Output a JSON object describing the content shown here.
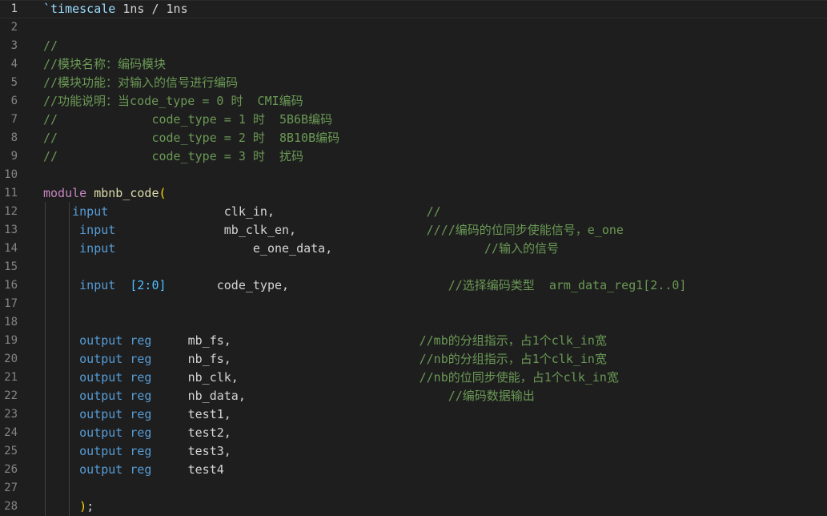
{
  "editor": {
    "lines": [
      {
        "n": "1",
        "segs": [
          {
            "t": "`timescale",
            "c": "directive"
          },
          {
            "t": " 1ns / 1ns",
            "c": "plain"
          }
        ]
      },
      {
        "n": "2",
        "segs": []
      },
      {
        "n": "3",
        "segs": [
          {
            "t": "//",
            "c": "comment"
          }
        ]
      },
      {
        "n": "4",
        "segs": [
          {
            "t": "//模块名称：编码模块",
            "c": "comment"
          }
        ]
      },
      {
        "n": "5",
        "segs": [
          {
            "t": "//模块功能：对输入的信号进行编码",
            "c": "comment"
          }
        ]
      },
      {
        "n": "6",
        "segs": [
          {
            "t": "//功能说明：当code_type = 0 时  CMI编码",
            "c": "comment"
          }
        ]
      },
      {
        "n": "7",
        "segs": [
          {
            "t": "//             code_type = 1 时  5B6B编码",
            "c": "comment"
          }
        ]
      },
      {
        "n": "8",
        "segs": [
          {
            "t": "//             code_type = 2 时  8B10B编码",
            "c": "comment"
          }
        ]
      },
      {
        "n": "9",
        "segs": [
          {
            "t": "//             code_type = 3 时  扰码",
            "c": "comment"
          }
        ]
      },
      {
        "n": "10",
        "segs": []
      },
      {
        "n": "11",
        "segs": [
          {
            "t": "module",
            "c": "module"
          },
          {
            "t": " ",
            "c": "plain"
          },
          {
            "t": "mbnb_code",
            "c": "modname"
          },
          {
            "t": "(",
            "c": "bracket"
          }
        ]
      },
      {
        "n": "12",
        "segs": [
          {
            "t": "    input",
            "c": "keyword"
          },
          {
            "t": "                clk_in,                     ",
            "c": "ident"
          },
          {
            "t": "//",
            "c": "comment"
          }
        ]
      },
      {
        "n": "13",
        "segs": [
          {
            "t": "     input",
            "c": "keyword"
          },
          {
            "t": "               mb_clk_en,                  ",
            "c": "ident"
          },
          {
            "t": "////编码的位同步使能信号，e_one",
            "c": "comment"
          }
        ]
      },
      {
        "n": "14",
        "segs": [
          {
            "t": "     input",
            "c": "keyword"
          },
          {
            "t": "                   e_one_data,                     ",
            "c": "ident"
          },
          {
            "t": "//输入的信号",
            "c": "comment"
          }
        ]
      },
      {
        "n": "15",
        "segs": []
      },
      {
        "n": "16",
        "segs": [
          {
            "t": "     input",
            "c": "keyword"
          },
          {
            "t": "  ",
            "c": "plain"
          },
          {
            "t": "[2:0]",
            "c": "range"
          },
          {
            "t": "       code_type,                      ",
            "c": "ident"
          },
          {
            "t": "//选择编码类型  arm_data_reg1[2..0]",
            "c": "comment"
          }
        ]
      },
      {
        "n": "17",
        "segs": []
      },
      {
        "n": "18",
        "segs": []
      },
      {
        "n": "19",
        "segs": [
          {
            "t": "     output reg",
            "c": "keyword"
          },
          {
            "t": "     mb_fs,                          ",
            "c": "ident"
          },
          {
            "t": "//mb的分组指示，占1个clk_in宽",
            "c": "comment"
          }
        ]
      },
      {
        "n": "20",
        "segs": [
          {
            "t": "     output reg",
            "c": "keyword"
          },
          {
            "t": "     nb_fs,                          ",
            "c": "ident"
          },
          {
            "t": "//nb的分组指示，占1个clk_in宽",
            "c": "comment"
          }
        ]
      },
      {
        "n": "21",
        "segs": [
          {
            "t": "     output reg",
            "c": "keyword"
          },
          {
            "t": "     nb_clk,                         ",
            "c": "ident"
          },
          {
            "t": "//nb的位同步使能，占1个clk_in宽",
            "c": "comment"
          }
        ]
      },
      {
        "n": "22",
        "segs": [
          {
            "t": "     output reg",
            "c": "keyword"
          },
          {
            "t": "     nb_data,                            ",
            "c": "ident"
          },
          {
            "t": "//编码数据输出",
            "c": "comment"
          }
        ]
      },
      {
        "n": "23",
        "segs": [
          {
            "t": "     output reg",
            "c": "keyword"
          },
          {
            "t": "     test1,",
            "c": "ident"
          }
        ]
      },
      {
        "n": "24",
        "segs": [
          {
            "t": "     output reg",
            "c": "keyword"
          },
          {
            "t": "     test2,",
            "c": "ident"
          }
        ]
      },
      {
        "n": "25",
        "segs": [
          {
            "t": "     output reg",
            "c": "keyword"
          },
          {
            "t": "     test3,",
            "c": "ident"
          }
        ]
      },
      {
        "n": "26",
        "segs": [
          {
            "t": "     output reg",
            "c": "keyword"
          },
          {
            "t": "     test4",
            "c": "ident"
          }
        ]
      },
      {
        "n": "27",
        "segs": []
      },
      {
        "n": "28",
        "segs": [
          {
            "t": "     ",
            "c": "plain"
          },
          {
            "t": ")",
            "c": "bracket"
          },
          {
            "t": ";",
            "c": "plain"
          }
        ]
      }
    ]
  }
}
